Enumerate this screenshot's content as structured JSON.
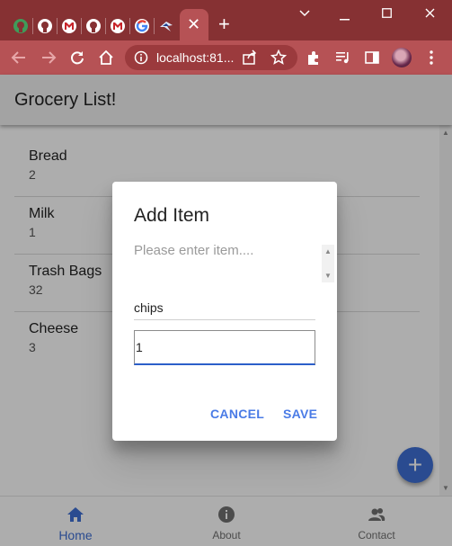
{
  "browser": {
    "url": "localhost:81...",
    "close_tab_glyph": "✕",
    "new_tab_glyph": "+",
    "tab_icons": [
      "github-icon",
      "github-icon",
      "gmail-icon",
      "github-icon",
      "gmail-icon",
      "google-icon",
      "app-icon"
    ]
  },
  "app": {
    "title": "Grocery List!",
    "items": [
      {
        "name": "Bread",
        "qty": "2"
      },
      {
        "name": "Milk",
        "qty": "1"
      },
      {
        "name": "Trash Bags",
        "qty": "32"
      },
      {
        "name": "Cheese",
        "qty": "3"
      }
    ],
    "fab_label": "+",
    "nav": [
      {
        "label": "Home",
        "icon": "home-icon",
        "active": true
      },
      {
        "label": "About",
        "icon": "info-icon",
        "active": false
      },
      {
        "label": "Contact",
        "icon": "contact-icon",
        "active": false
      }
    ]
  },
  "dialog": {
    "title": "Add Item",
    "item_placeholder": "Please enter item....",
    "item_value": "chips",
    "quantity_value": "1",
    "cancel_label": "CANCEL",
    "save_label": "SAVE"
  },
  "colors": {
    "tabbar": "#863133",
    "toolbar": "#b65255",
    "accent": "#3f6fd4",
    "button_text": "#4a7be6"
  }
}
